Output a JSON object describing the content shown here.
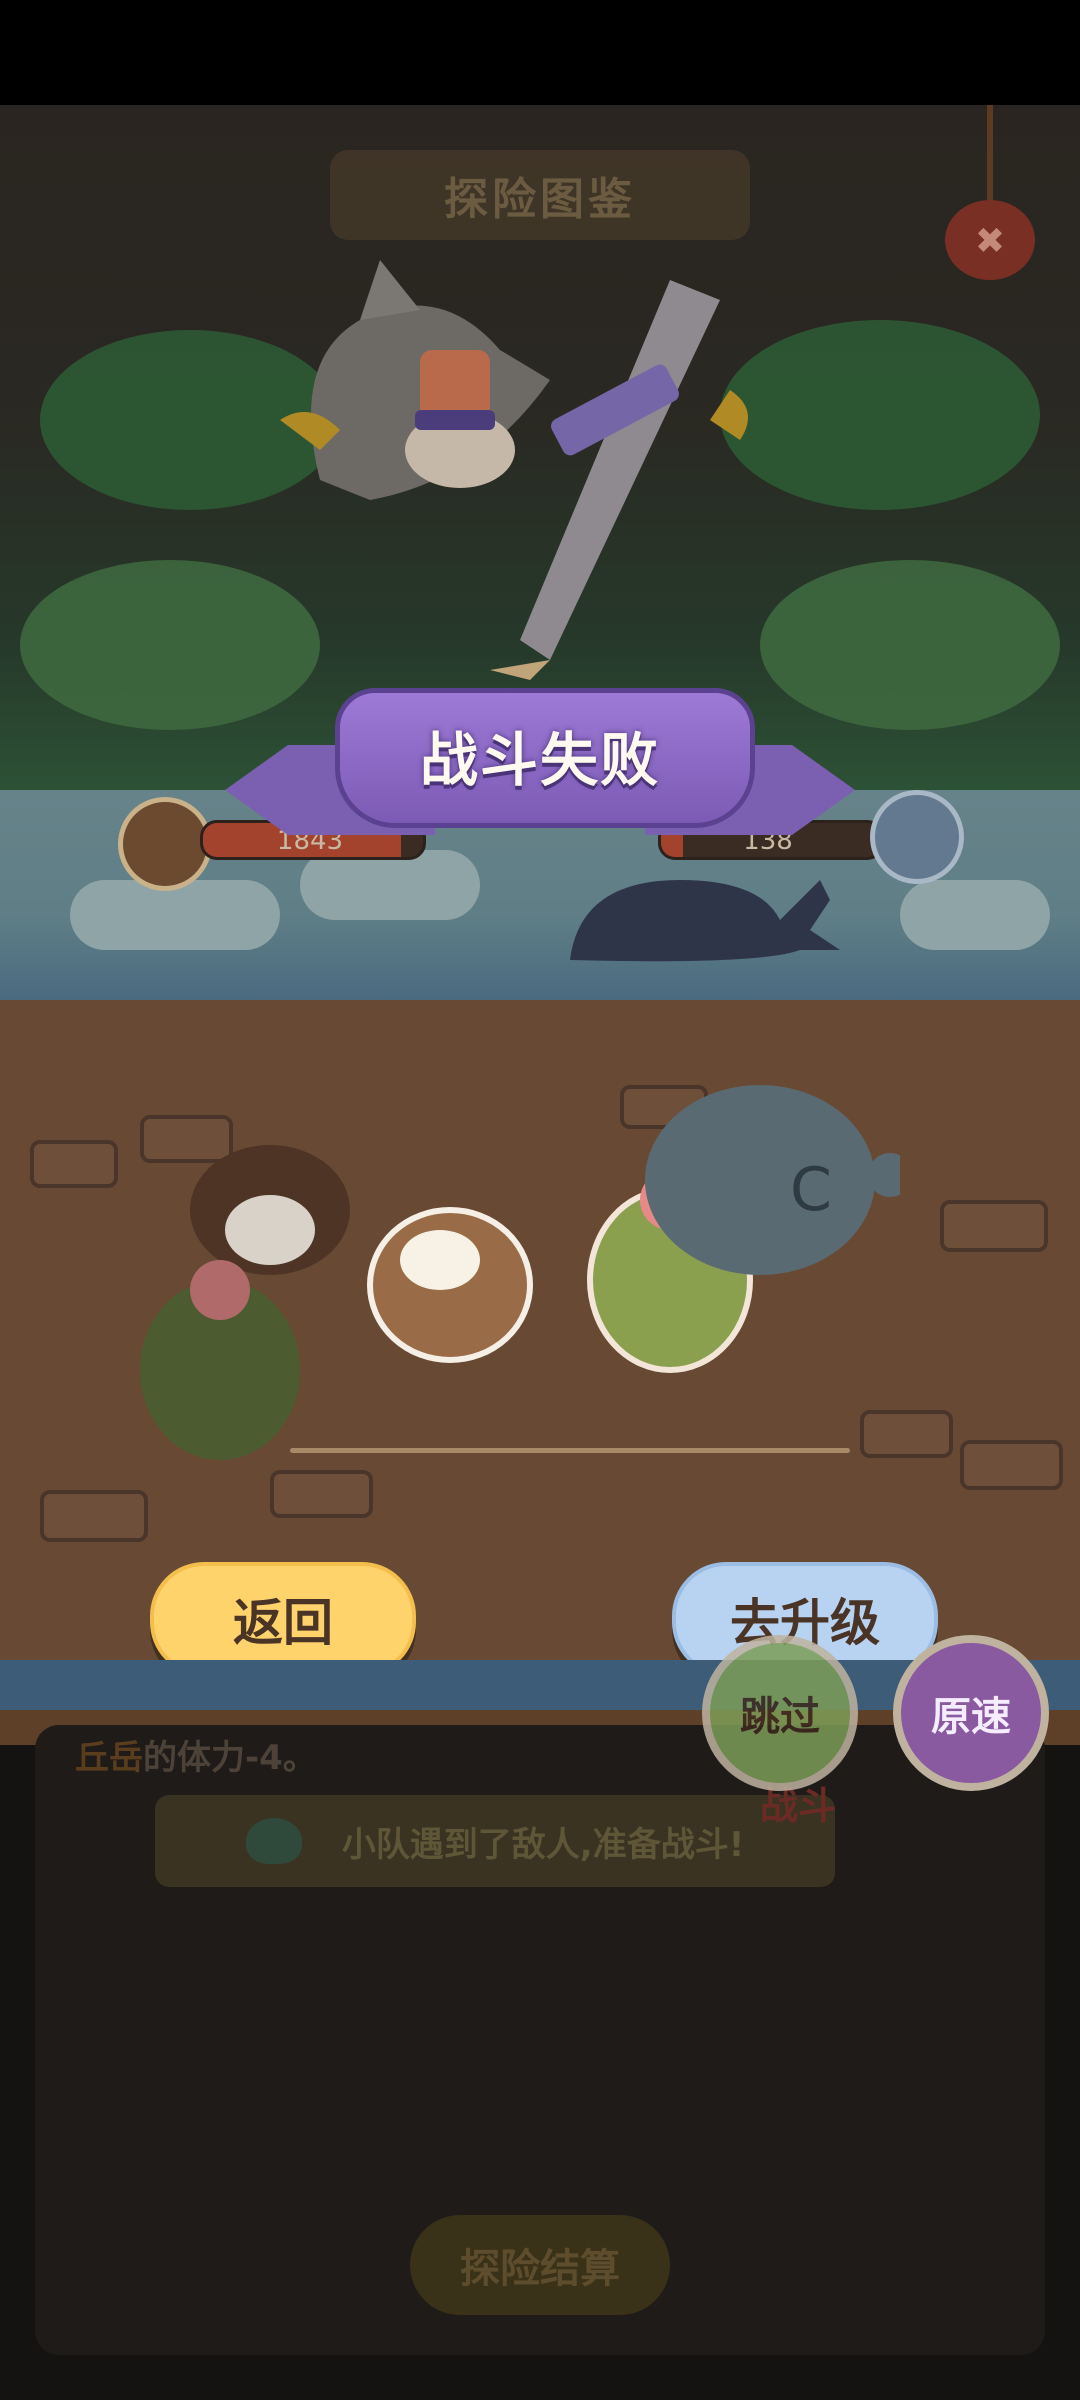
{
  "header": {
    "title": "探险图鉴"
  },
  "battle": {
    "result_title": "战斗失败",
    "player_hp": "1843",
    "enemy_hp": "138",
    "player_hp_fraction": 0.9,
    "enemy_hp_fraction": 0.1
  },
  "actions": {
    "back_label": "返回",
    "upgrade_label": "去升级",
    "skip_label": "跳过",
    "speed_label": "原速"
  },
  "log": {
    "name": "丘岳",
    "stamina_text": "的体力-4。",
    "encounter_text": "小队遇到了敌人,准备战斗!",
    "battle_tag": "战斗",
    "settle_label": "探险结算"
  },
  "colors": {
    "banner": "#8a68c4",
    "back_button": "#ffd36b",
    "upgrade_button": "#b7d3f1",
    "skip_button": "#7d9d58",
    "speed_button": "#8a5aa0",
    "hp_fill": "#a3432d"
  }
}
